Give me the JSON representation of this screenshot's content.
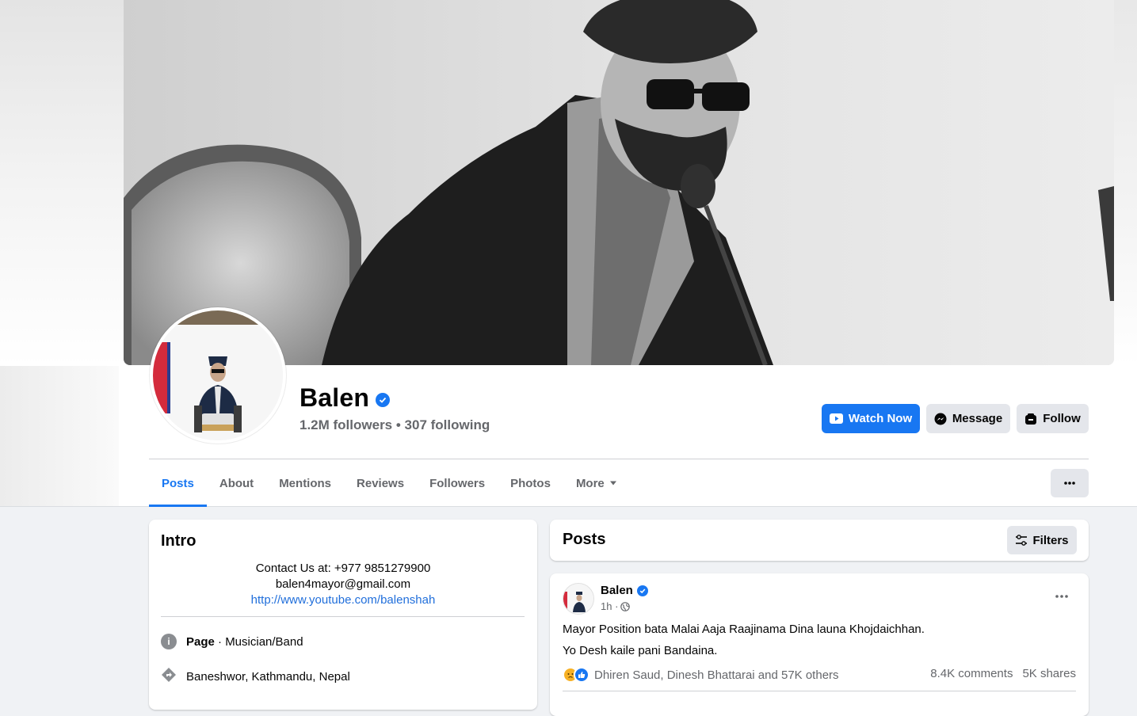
{
  "page": {
    "name": "Balen",
    "followers": "1.2M followers",
    "following": "307 following",
    "separator": " • "
  },
  "actions": {
    "watch_now": "Watch Now",
    "message": "Message",
    "follow": "Follow"
  },
  "tabs": [
    {
      "label": "Posts",
      "active": true
    },
    {
      "label": "About"
    },
    {
      "label": "Mentions"
    },
    {
      "label": "Reviews"
    },
    {
      "label": "Followers"
    },
    {
      "label": "Photos"
    },
    {
      "label": "More"
    }
  ],
  "intro": {
    "title": "Intro",
    "contact": "Contact Us at: +977 9851279900",
    "email": "balen4mayor@gmail.com",
    "link": "http://www.youtube.com/balenshah",
    "category_prefix": "Page",
    "category": " · Musician/Band",
    "location": "Baneshwor, Kathmandu, Nepal"
  },
  "posts": {
    "title": "Posts",
    "filters": "Filters"
  },
  "post": {
    "author": "Balen",
    "time": "1h ·",
    "line1": "Mayor Position bata Malai Aaja Raajinama Dina launa Khojdaichhan.",
    "line2": "Yo Desh kaile pani Bandaina.",
    "reactors": "Dhiren Saud, Dinesh Bhattarai and 57K others",
    "comments": "8.4K comments",
    "shares": "5K shares"
  },
  "colors": {
    "accent": "#1877f2",
    "link": "#216fdb",
    "muted": "#65676b"
  }
}
